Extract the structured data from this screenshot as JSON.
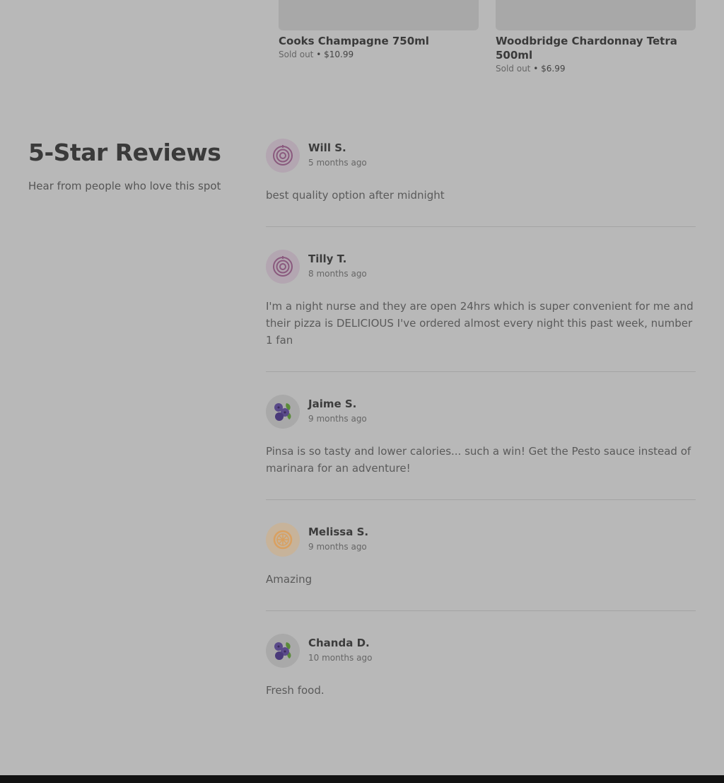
{
  "products": [
    {
      "name": "Cooks Champagne 750ml",
      "status": "Sold out",
      "sep": "•",
      "price": "$10.99"
    },
    {
      "name": "Woodbridge Chardonnay Tetra 500ml",
      "status": "Sold out",
      "sep": "•",
      "price": "$6.99"
    }
  ],
  "section": {
    "title": "5-Star Reviews",
    "subtitle": "Hear from people who love this spot"
  },
  "reviews": [
    {
      "name": "Will S.",
      "time": "5 months ago",
      "avatar": "target-icon",
      "text": "best quality option after midnight"
    },
    {
      "name": "Tilly T.",
      "time": "8 months ago",
      "avatar": "target-icon",
      "text": "I'm a night nurse and they are open 24hrs which is super convenient for me and their pizza is DELICIOUS I've ordered almost every night this past week, number 1 fan"
    },
    {
      "name": "Jaime S.",
      "time": "9 months ago",
      "avatar": "blueberry-icon",
      "text": "Pinsa is so tasty and lower calories... such a win! Get the Pesto sauce instead of marinara for an adventure!"
    },
    {
      "name": "Melissa S.",
      "time": "9 months ago",
      "avatar": "citrus-icon",
      "text": "Amazing"
    },
    {
      "name": "Chanda D.",
      "time": "10 months ago",
      "avatar": "blueberry-icon",
      "text": "Fresh food."
    }
  ],
  "colors": {
    "overlay_bg": "#b8b8b8",
    "target": "#8a5a7e",
    "berry": "#5a4a8a",
    "leaf": "#5a8a3a",
    "citrus": "#d9a060"
  }
}
